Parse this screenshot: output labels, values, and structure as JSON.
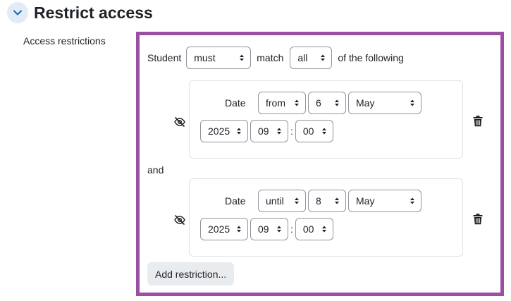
{
  "section": {
    "title": "Restrict access"
  },
  "field_label": "Access restrictions",
  "header_row": {
    "student_label": "Student",
    "must_select": "must",
    "match_label": "match",
    "all_select": "all",
    "suffix": "of the following"
  },
  "conditions": [
    {
      "type_label": "Date",
      "direction": "from",
      "day": "6",
      "month": "May",
      "year": "2025",
      "hour": "09",
      "minute": "00"
    },
    {
      "type_label": "Date",
      "direction": "until",
      "day": "8",
      "month": "May",
      "year": "2025",
      "hour": "09",
      "minute": "00"
    }
  ],
  "connector": "and",
  "time_separator": ":",
  "add_button_label": "Add restriction...",
  "colors": {
    "accent_border": "#9b4fa3",
    "collapse_bg": "#e3ebf6",
    "collapse_icon": "#0f6cbf"
  }
}
